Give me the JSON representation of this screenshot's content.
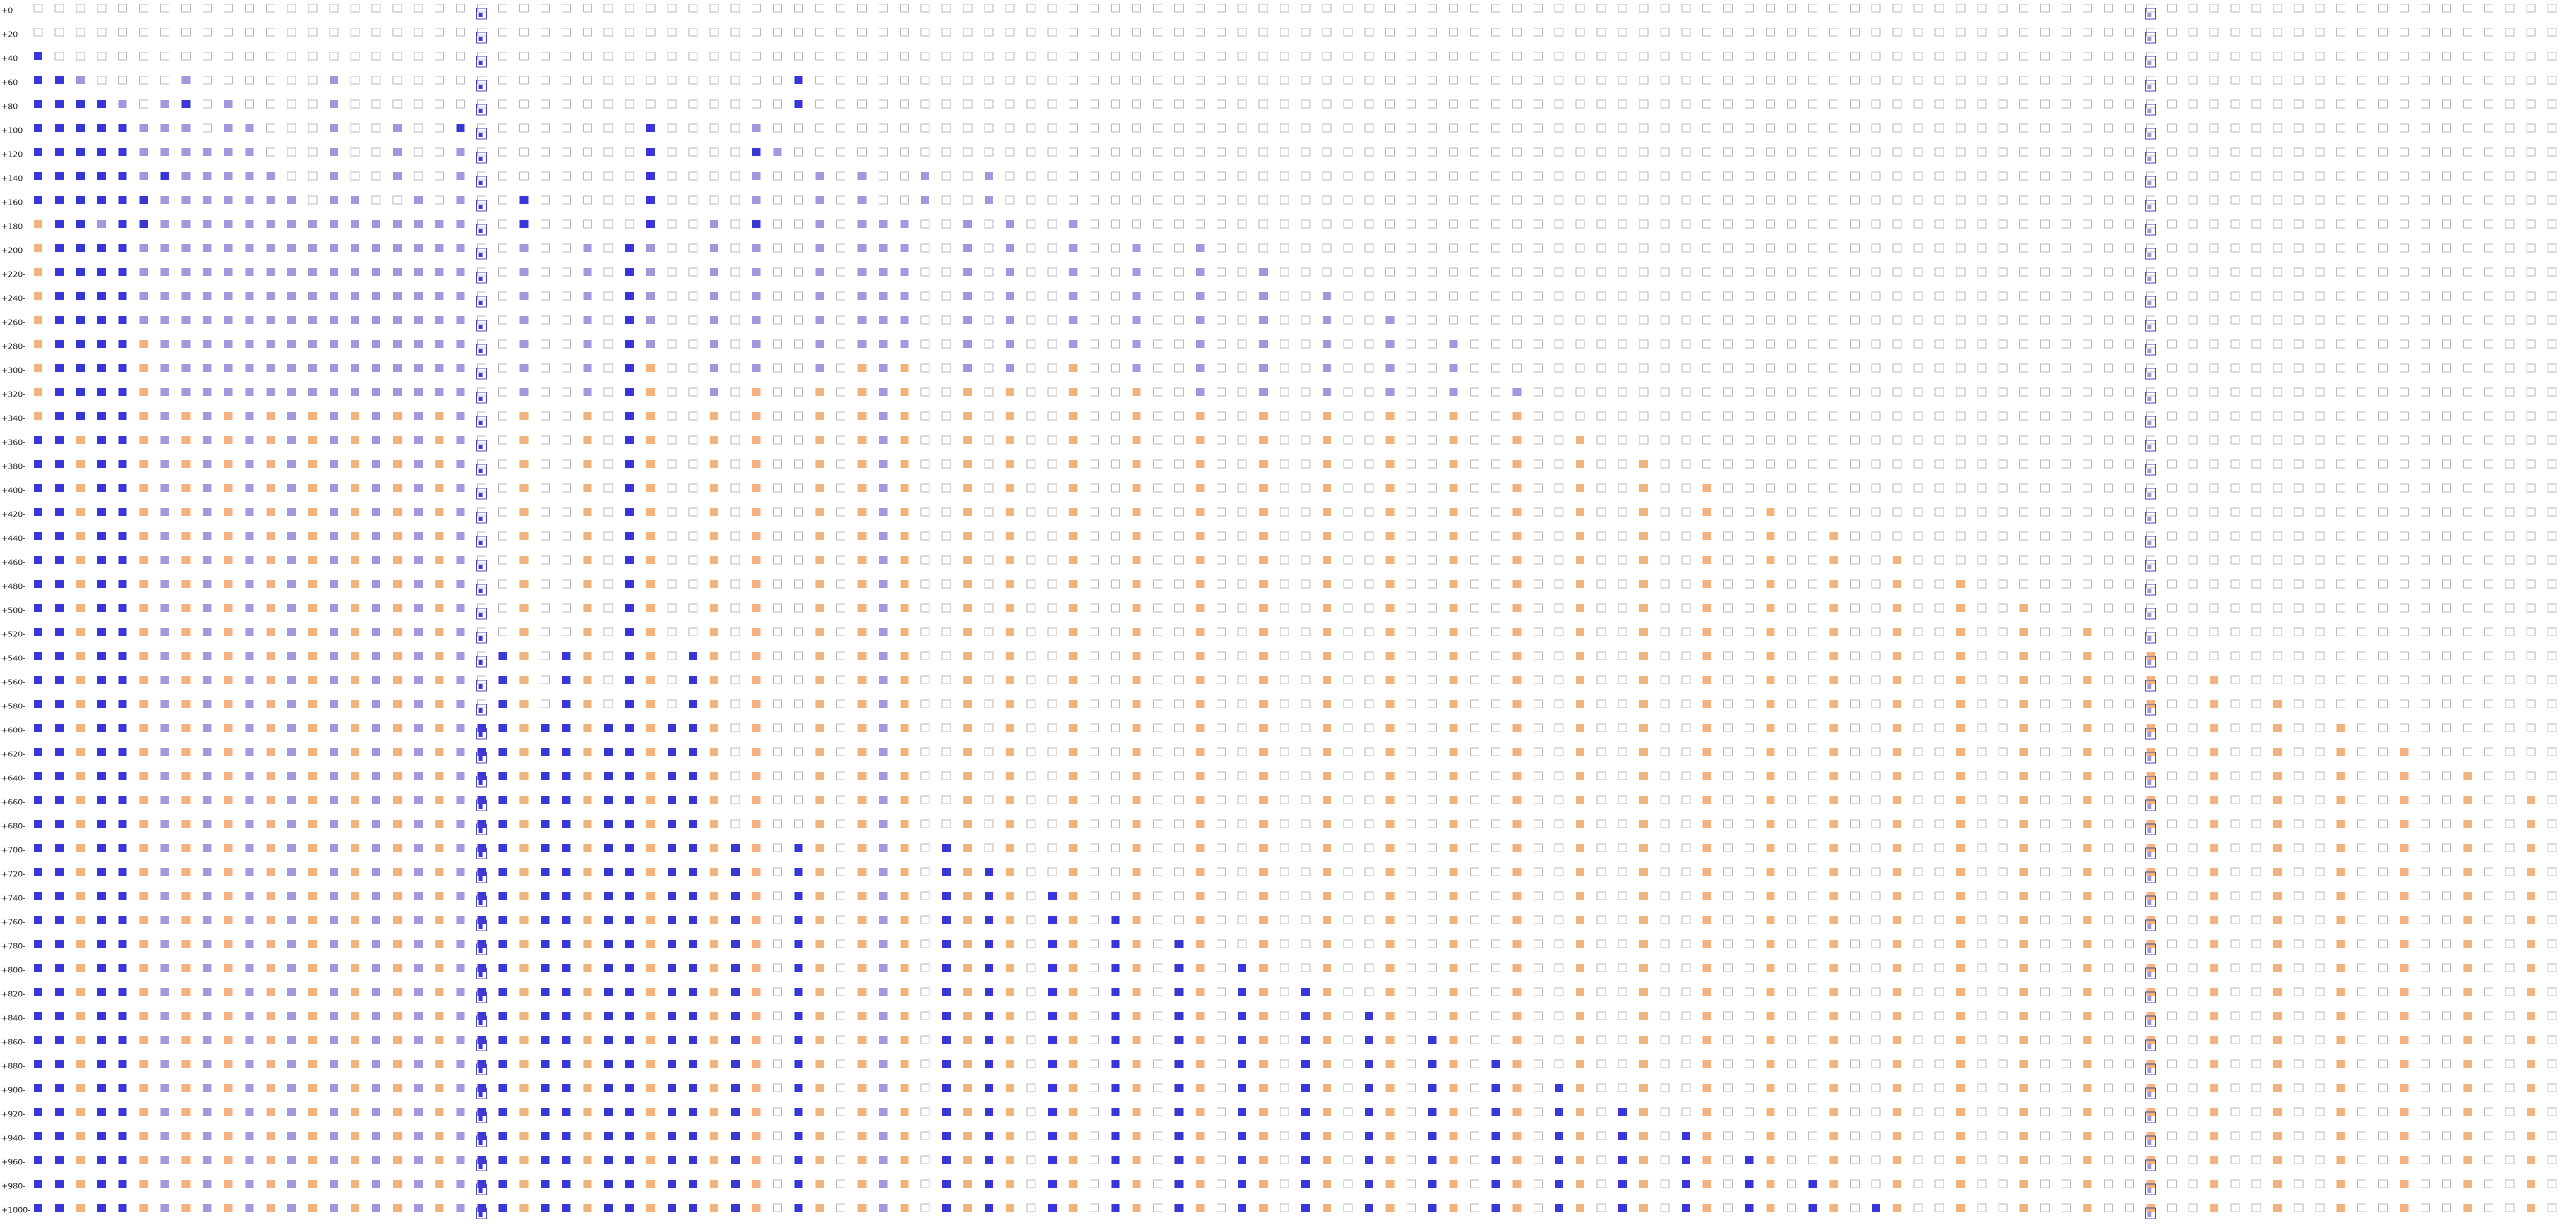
{
  "chart_data": {
    "type": "heatmap",
    "title": "",
    "xlabel": "",
    "ylabel": "",
    "y_tick_labels": [
      "0",
      "20",
      "40",
      "60",
      "80",
      "100",
      "120",
      "140",
      "160",
      "180",
      "200",
      "220",
      "240",
      "260",
      "280",
      "300",
      "320",
      "340",
      "360",
      "380",
      "400",
      "420",
      "440",
      "460",
      "480",
      "500",
      "520",
      "540",
      "560",
      "580",
      "600",
      "620",
      "640",
      "660",
      "680",
      "700",
      "720",
      "740",
      "760",
      "780",
      "800",
      "820",
      "840",
      "860",
      "880",
      "900",
      "920",
      "940",
      "960",
      "980",
      "1000"
    ],
    "column_count": 120,
    "grid": false,
    "legend": "none",
    "colors": {
      "empty_fill": "#ffffff",
      "empty_stroke": "#b8b8b8",
      "dark": "#3a35d6",
      "light": "#9f9ae0",
      "orange": "#f3b27c",
      "special_outline": "#4a45c0"
    },
    "state_codes": {
      "0": "empty",
      "1": "dark",
      "2": "light",
      "3": "orange"
    },
    "special_columns": [
      21,
      100
    ],
    "grid_rows": [
      "000000000000000000000000000000000000000000000000000000000000000000000000000000000000000000000000000000000000000000000000",
      "000000000000000000000000000000000000000000000000000000000000000000000000000000000000000000000000000000000000000000000000",
      "100000000000000000000000000000000000000000000000000000000000000000000000000000000000000000000000000000000000000000000000",
      "112000020000002000000000000000000000100000000000000000000000000000000000000000000000000000000000000000000000000000000000",
      "111120210200002000000000000000000000100000000000000000000000000000000000000000000000000000000000000000000000000000000000",
      "111112220220002002001000000001000020000000000000000000000000000000000000000000000000000000000000000000000000000000000000",
      "111112222220002002002000000001000012000000000000000000000000000000000000000000000000000000000000000000000000000000000000",
      "111112122222002002002000000001000020020200200200000000000000000000000000000000000000000000000000000000000000000000000000",
      "111111222222202200202001000001000020020200200200000000000000000000000000000000000000000000000000000000000000000000000000",
      "311211222222222222222001000001002010020222002020020000000000000000000000000000000000000000000000000000000000000000000000",
      "311112222222222222222002002012002020020222002020020020020000000000000000000000000000000000000000000000000000000000000000",
      "311112222222222222222002002012002020020222002020020020020020000000000000000000000000000000000000000000000000000000000000",
      "311112222222222222222002002012002020020222002020020020020020020000000000000000000000000000000000000000000000000000000000",
      "311112222222222222222002002012002020020222002020020020020020020020000000000000000000000000000000000000000000000000000000",
      "311113222222222222222002002012002020020222002020020020020020020020020000000000000000000000000000000000000000000000000000",
      "311113222222222222222002002013002020020323002020030020020020020020020000000000000000000000000000000000000000000000000000",
      "311113222222222222222002002013002030030323003030030030020020020020020020000000000000000000000000000000000000000000000000",
      "311113232323232323232003003013003030030323003030030030030030030030030030000000000000000000000000000000000000000000000000",
      "113113232323232323232003003013003030030323003030030030030030030030030030030000000000000000000000000000000000000000000000",
      "113113232323232323232003003013003030030323003030030030030030030030030030030030000000000000000000000000000000000000000000",
      "113113232323232323232003003013003030030323003030030030030030030030030030030030030000000000000000000000000000000000000000",
      "113113232323232323232003003013003030030323003030030030030030030030030030030030030030000000000000000000000000000000000000",
      "113113232323232323232003003013003030030323003030030030030030030030030030030030030030030000000000000000000000000000000000",
      "113113232323232323232003003013003030030323003030030030030030030030030030030030030030030030000000000000000000000000000000",
      "113113232323232323232003003013003030030323003030030030030030030030030030030030030030030030030000000000000000000000000000",
      "113113232323232323232003003013003030030323003030030030030030030030030030030030030030030030030030000000000000000000000000",
      "113113232323232323232003003013003030030323003030030030030030030030030030030030030030030030030030030000000000000000000000",
      "113113232323232323232013013013013030030323003030030030030030030030030030030030030030030030030030030030000000000000000000",
      "113113232323232323232013013013013030030323003030030030030030030030030030030030030030030030030030030030030000000000000000",
      "113113232323232323232013013013013030030323003030030030030030030030030030030030030030030030030030030030030030000000000000",
      "113113232323232323232113113113113030030323003030030030030030030030030030030030030030030030030030030030030030030000000000",
      "113113232323232323232113113113113030030323003030030030030030030030030030030030030030030030030030030030030030030030000000",
      "113113232323232323232113113113113030030323003030030030030030030030030030030030030030030030030030030030030030030030030000",
      "113113232323232323232113113113113030030323003030030030030030030030030030030030030030030030030030030030030030030030030030",
      "113113232323232323232113113113113030030323003030030030030030030030030030030030030030030030030030030030030030030030030030",
      "113113232323232323232113113113113130130323013030030030030030030030030030030030030030030030030030030030030030030030030030",
      "113113232323232323232113113113113130130323013130030030030030030030030030030030030030030030030030030030030030030030030030",
      "113113232323232323232113113113113130130323013130130030030030030030030030030030030030030030030030030030030030030030030030",
      "113113232323232323232113113113113130130323013130130130030030030030030030030030030030030030030030030030030030030030030030",
      "113113232323232323232113113113113130130323013130130130130030030030030030030030030030030030030030030030030030030030030030",
      "113113232323232323232113113113113130130323013130130130130130030030030030030030030030030030030030030030030030030030030030",
      "113113232323232323232113113113113130130323013130130130130130130030030030030030030030030030030030030030030030030030030030",
      "113113232323232323232113113113113130130323013130130130130130130130030030030030030030030030030030030030030030030030030030",
      "113113232323232323232113113113113130130323013130130130130130130130130030030030030030030030030030030030030030030030030030",
      "113113232323232323232113113113113130130323013130130130130130130130130130030030030030030030030030030030030030030030030030",
      "113113232323232323232113113113113130130323013130130130130130130130130130130030030030030030030030030030030030030030030030",
      "113113232323232323232113113113113130130323013130130130130130130130130130130130030030030030030030030030030030030030030030",
      "113113232323232323232113113113113130130323013130130130130130130130130130130130130030030030030030030030030030030030030030",
      "113113232323232323232113113113113130130323013130130130130130130130130130130130130130030030030030030030030030030030030030",
      "113113232323232323232113113113113130130323013130130130130130130130130130130130130130130030030030030030030030030030030030",
      "113113232323232323232113113113113130130323013130130130130130130130130130130130130130130130030030030030030030030030030030"
    ]
  }
}
